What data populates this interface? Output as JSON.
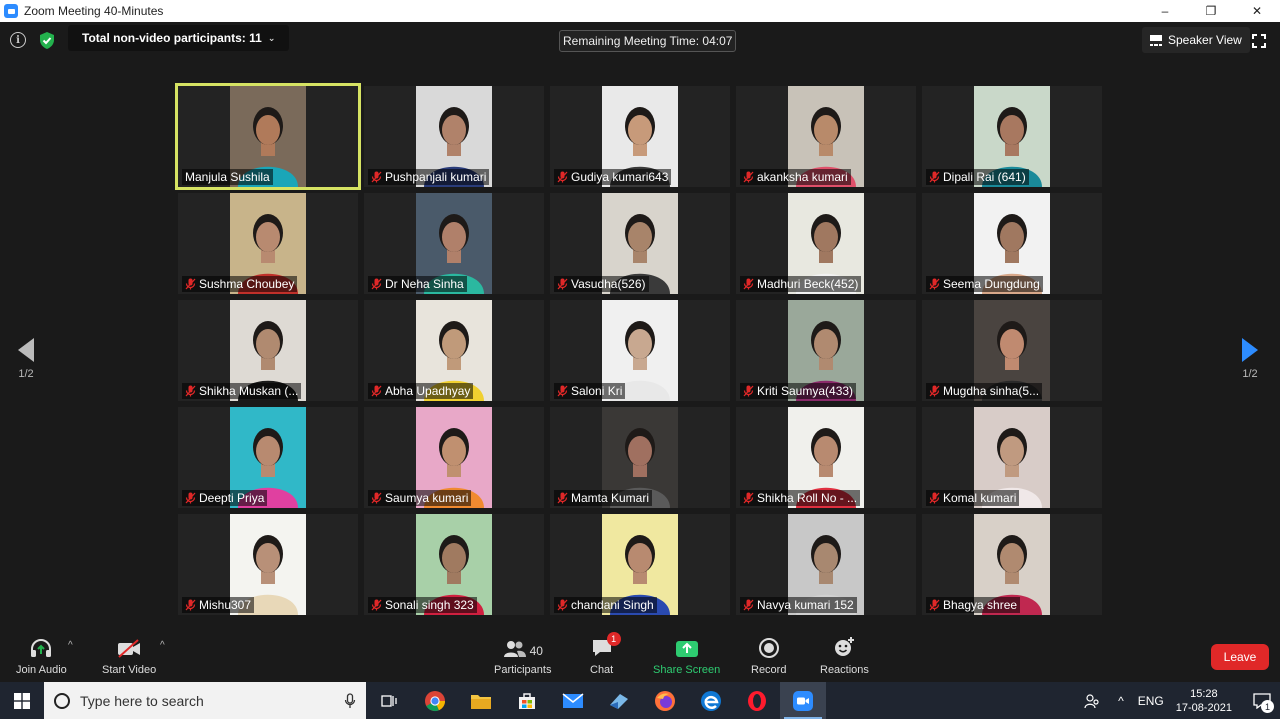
{
  "window": {
    "title": "Zoom Meeting 40-Minutes",
    "minimize": "–",
    "maximize": "❐",
    "close": "✕"
  },
  "topbar": {
    "info_icon": "info-icon",
    "shield_icon": "shield-check-icon",
    "non_video_label": "Total non-video participants: 11",
    "remaining_time": "Remaining Meeting Time: 04:07",
    "speaker_view_label": "Speaker View",
    "fullscreen_icon": "fullscreen-icon"
  },
  "pagination": {
    "left_label": "1/2",
    "right_label": "1/2"
  },
  "participants": [
    {
      "name": "Manjula Sushila",
      "muted": false,
      "active": true,
      "bg": "#7a6a5a",
      "shirt": "#1aa6b8",
      "skin": "#b07a5a"
    },
    {
      "name": "Pushpanjali kumari",
      "muted": true,
      "active": false,
      "bg": "#d9d9d9",
      "shirt": "#2a3c7a",
      "skin": "#b0826a"
    },
    {
      "name": "Gudiya kumari643",
      "muted": true,
      "active": false,
      "bg": "#e9e9e9",
      "shirt": "#3a3a3a",
      "skin": "#c79a7a"
    },
    {
      "name": "akanksha kumari",
      "muted": true,
      "active": false,
      "bg": "#c8c2b8",
      "shirt": "#e0506a",
      "skin": "#b88a6a"
    },
    {
      "name": "Dipali Rai (641)",
      "muted": true,
      "active": false,
      "bg": "#c9d8c9",
      "shirt": "#1a8a9a",
      "skin": "#a87860"
    },
    {
      "name": "Sushma Choubey",
      "muted": true,
      "active": false,
      "bg": "#c8b48a",
      "shirt": "#c0302a",
      "skin": "#b88a70"
    },
    {
      "name": "Dr Neha Sinha",
      "muted": true,
      "active": false,
      "bg": "#4a5a6a",
      "shirt": "#2bb8a0",
      "skin": "#b0806a"
    },
    {
      "name": "Vasudha(526)",
      "muted": true,
      "active": false,
      "bg": "#d8d4cc",
      "shirt": "#3a3a3a",
      "skin": "#a8846a"
    },
    {
      "name": "Madhuri Beck(452)",
      "muted": true,
      "active": false,
      "bg": "#e8e8e0",
      "shirt": "#f2f2f2",
      "skin": "#a07860"
    },
    {
      "name": "Seema Dungdung",
      "muted": true,
      "active": false,
      "bg": "#f2f2f2",
      "shirt": "#d8a88a",
      "skin": "#a07860"
    },
    {
      "name": "Shikha Muskan (...",
      "muted": true,
      "active": false,
      "bg": "#dedad4",
      "shirt": "#1a1a1a",
      "skin": "#b08a70"
    },
    {
      "name": "Abha Upadhyay",
      "muted": true,
      "active": false,
      "bg": "#e8e4dc",
      "shirt": "#f0d030",
      "skin": "#c09a7a"
    },
    {
      "name": "Saloni Kri",
      "muted": true,
      "active": false,
      "bg": "#f0f0f0",
      "shirt": "#e8e8e8",
      "skin": "#c8a890"
    },
    {
      "name": "Kriti Saumya(433)",
      "muted": true,
      "active": false,
      "bg": "#9aa89a",
      "shirt": "#8a2a6a",
      "skin": "#b08a70"
    },
    {
      "name": "Mugdha sinha(5...",
      "muted": true,
      "active": false,
      "bg": "#4a4440",
      "shirt": "#2a2a2a",
      "skin": "#c08a70"
    },
    {
      "name": "Deepti Priya",
      "muted": true,
      "active": false,
      "bg": "#30b8c8",
      "shirt": "#e040a0",
      "skin": "#b88a70"
    },
    {
      "name": "Saumya kumari",
      "muted": true,
      "active": false,
      "bg": "#e8a8c8",
      "shirt": "#f08a30",
      "skin": "#c09070"
    },
    {
      "name": "Mamta Kumari",
      "muted": true,
      "active": false,
      "bg": "#3a3836",
      "shirt": "#5a5a5a",
      "skin": "#a07060"
    },
    {
      "name": "Shikha Roll No - ...",
      "muted": true,
      "active": false,
      "bg": "#f0f0ec",
      "shirt": "#e03040",
      "skin": "#b88a70"
    },
    {
      "name": "Komal kumari",
      "muted": true,
      "active": false,
      "bg": "#d8ccc8",
      "shirt": "#f0e8e8",
      "skin": "#c09a80"
    },
    {
      "name": "Mishu307",
      "muted": true,
      "active": false,
      "bg": "#f4f4f0",
      "shirt": "#e8d8b8",
      "skin": "#b89078"
    },
    {
      "name": "Sonali singh 323",
      "muted": true,
      "active": false,
      "bg": "#a8d0a8",
      "shirt": "#d02040",
      "skin": "#a07a60"
    },
    {
      "name": "chandani Singh",
      "muted": true,
      "active": false,
      "bg": "#f0e8a0",
      "shirt": "#2a4ab0",
      "skin": "#b88a70"
    },
    {
      "name": "Navya kumari 152",
      "muted": true,
      "active": false,
      "bg": "#c8c8c8",
      "shirt": "#d0d0d0",
      "skin": "#a88870"
    },
    {
      "name": "Bhagya shree",
      "muted": true,
      "active": false,
      "bg": "#d8d0c8",
      "shirt": "#c02850",
      "skin": "#b08a70"
    }
  ],
  "toolbar": {
    "join_audio": "Join Audio",
    "start_video": "Start Video",
    "participants_label": "Participants",
    "participants_count": "40",
    "chat_label": "Chat",
    "chat_badge": "1",
    "share_screen": "Share Screen",
    "record": "Record",
    "reactions": "Reactions",
    "leave": "Leave",
    "share_color": "#2ecc71",
    "leave_color": "#e02828"
  },
  "taskbar": {
    "search_placeholder": "Type here to search",
    "language": "ENG",
    "time": "15:28",
    "date": "17-08-2021",
    "notification_count": "1",
    "apps": [
      "task-view-icon",
      "chrome-icon",
      "file-explorer-icon",
      "store-icon",
      "mail-icon",
      "edge-legacy-icon",
      "firefox-icon",
      "edge-icon",
      "opera-icon",
      "zoom-icon"
    ]
  }
}
